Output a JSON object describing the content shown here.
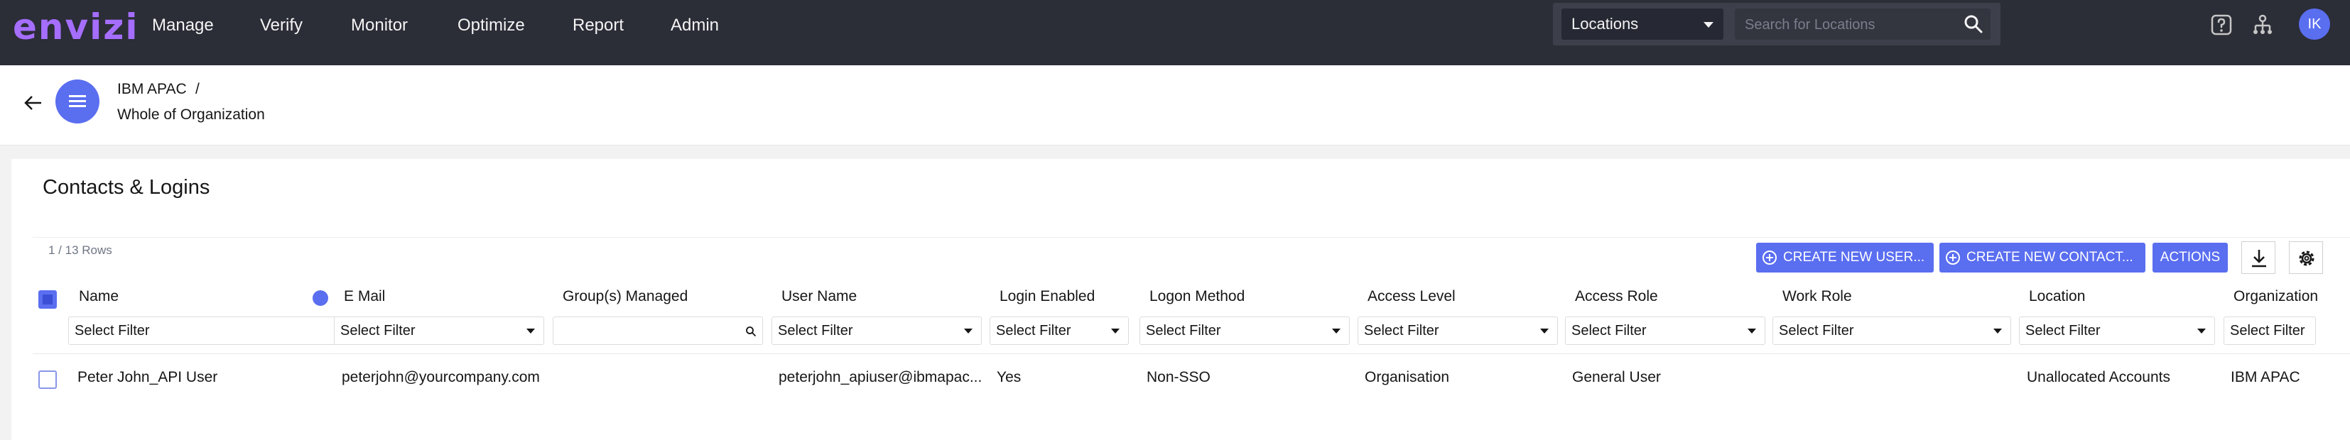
{
  "app": {
    "logo_text": "envizi",
    "brand_color": "#a56eff",
    "accent_color": "#5a6ef0"
  },
  "nav": {
    "items": [
      "Manage",
      "Verify",
      "Monitor",
      "Optimize",
      "Report",
      "Admin"
    ]
  },
  "location_search": {
    "selected": "Locations",
    "placeholder": "Search for Locations"
  },
  "header_icons": [
    "help-icon",
    "hierarchy-icon"
  ],
  "user": {
    "initials": "IK"
  },
  "breadcrumb": {
    "level1": "IBM APAC",
    "separator": "/",
    "level2": "Whole of Organization"
  },
  "page": {
    "title": "Contacts & Logins",
    "row_count": "1 / 13 Rows"
  },
  "toolbar": {
    "create_user": "CREATE NEW USER...",
    "create_contact": "CREATE NEW CONTACT...",
    "actions": "ACTIONS",
    "icons": [
      "download-icon",
      "settings-icon"
    ]
  },
  "table": {
    "columns": [
      "Name",
      "E Mail",
      "Group(s) Managed",
      "User Name",
      "Login Enabled",
      "Logon Method",
      "Access Level",
      "Access Role",
      "Work Role",
      "Location",
      "Organization"
    ],
    "filter_placeholder": "Select Filter",
    "rows": [
      {
        "name": "Peter John_API User",
        "email": "peterjohn@yourcompany.com",
        "groups": "",
        "username": "peterjohn_apiuser@ibmapac...",
        "login_enabled": "Yes",
        "logon_method": "Non-SSO",
        "access_level": "Organisation",
        "access_role": "General User",
        "work_role": "",
        "location": "Unallocated Accounts",
        "organization": "IBM APAC"
      }
    ]
  }
}
